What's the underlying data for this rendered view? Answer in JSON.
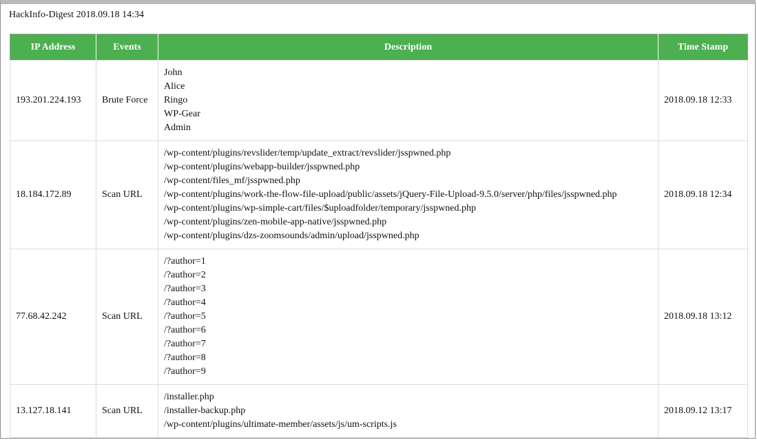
{
  "header": {
    "title": "HackInfo-Digest 2018.09.18 14:34"
  },
  "table": {
    "columns": [
      "IP Address",
      "Events",
      "Description",
      "Time Stamp"
    ],
    "rows": [
      {
        "ip": "193.201.224.193",
        "event": "Brute Force",
        "description": [
          "John",
          "Alice",
          "Ringo",
          "WP-Gear",
          "Admin"
        ],
        "timestamp": "2018.09.18 12:33"
      },
      {
        "ip": "18.184.172.89",
        "event": "Scan URL",
        "description": [
          "/wp-content/plugins/revslider/temp/update_extract/revslider/jsspwned.php",
          "/wp-content/plugins/webapp-builder/jsspwned.php",
          "/wp-content/files_mf/jsspwned.php",
          "/wp-content/plugins/work-the-flow-file-upload/public/assets/jQuery-File-Upload-9.5.0/server/php/files/jsspwned.php",
          "/wp-content/plugins/wp-simple-cart/files/$uploadfolder/temporary/jsspwned.php",
          "/wp-content/plugins/zen-mobile-app-native/jsspwned.php",
          "/wp-content/plugins/dzs-zoomsounds/admin/upload/jsspwned.php"
        ],
        "timestamp": "2018.09.18 12:34"
      },
      {
        "ip": "77.68.42.242",
        "event": "Scan URL",
        "description": [
          "/?author=1",
          "/?author=2",
          "/?author=3",
          "/?author=4",
          "/?author=5",
          "/?author=6",
          "/?author=7",
          "/?author=8",
          "/?author=9"
        ],
        "timestamp": "2018.09.18 13:12"
      },
      {
        "ip": "13.127.18.141",
        "event": "Scan URL",
        "description": [
          "/installer.php",
          "/installer-backup.php",
          "/wp-content/plugins/ultimate-member/assets/js/um-scripts.js"
        ],
        "timestamp": "2018.09.12 13:17"
      }
    ]
  },
  "colors": {
    "header_bg": "#4caf50",
    "header_text": "#ffffff",
    "grid": "#dcdcdc"
  }
}
